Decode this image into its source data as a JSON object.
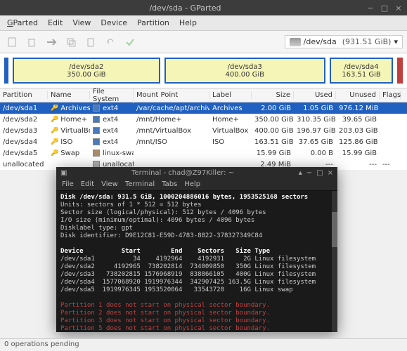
{
  "window": {
    "title": "/dev/sda - GParted"
  },
  "menu": {
    "gparted": "GParted",
    "edit": "Edit",
    "view": "View",
    "device": "Device",
    "partition": "Partition",
    "help": "Help"
  },
  "toolbar": {
    "device": "/dev/sda",
    "device_size": "(931.51 GiB)"
  },
  "partmap": {
    "s2_name": "/dev/sda2",
    "s2_size": "350.00 GiB",
    "s3_name": "/dev/sda3",
    "s3_size": "400.00 GiB",
    "s4_name": "/dev/sda4",
    "s4_size": "163.51 GiB"
  },
  "headers": {
    "partition": "Partition",
    "name": "Name",
    "fs": "File System",
    "mp": "Mount Point",
    "label": "Label",
    "size": "Size",
    "used": "Used",
    "unused": "Unused",
    "flags": "Flags"
  },
  "rows": [
    {
      "part": "/dev/sda1",
      "name": "Archives",
      "fs": "ext4",
      "fsc": "fs-ext4",
      "mp": "/var/cache/apt/archives",
      "label": "Archives",
      "size": "2.00 GiB",
      "used": "1.05 GiB",
      "unused": "976.12 MiB",
      "flags": "",
      "key": true,
      "sel": true
    },
    {
      "part": "/dev/sda2",
      "name": "Home+",
      "fs": "ext4",
      "fsc": "fs-ext4",
      "mp": "/mnt/Home+",
      "label": "Home+",
      "size": "350.00 GiB",
      "used": "310.35 GiB",
      "unused": "39.65 GiB",
      "flags": "",
      "key": true
    },
    {
      "part": "/dev/sda3",
      "name": "VirtualBox",
      "fs": "ext4",
      "fsc": "fs-ext4",
      "mp": "/mnt/VirtualBox",
      "label": "VirtualBox",
      "size": "400.00 GiB",
      "used": "196.97 GiB",
      "unused": "203.03 GiB",
      "flags": "",
      "key": true
    },
    {
      "part": "/dev/sda4",
      "name": "ISO",
      "fs": "ext4",
      "fsc": "fs-ext4",
      "mp": "/mnt/ISO",
      "label": "ISO",
      "size": "163.51 GiB",
      "used": "37.65 GiB",
      "unused": "125.86 GiB",
      "flags": "",
      "key": true
    },
    {
      "part": "/dev/sda5",
      "name": "Swap",
      "fs": "linux-swap",
      "fsc": "fs-swap",
      "mp": "",
      "label": "",
      "size": "15.99 GiB",
      "used": "0.00 B",
      "unused": "15.99 GiB",
      "flags": "",
      "key": true
    },
    {
      "part": "unallocated",
      "name": "",
      "fs": "unallocated",
      "fsc": "fs-unalloc",
      "mp": "",
      "label": "",
      "size": "2.49 MiB",
      "used": "---",
      "unused": "---",
      "flags": "---",
      "key": false
    }
  ],
  "terminal": {
    "title": "Terminal - chad@Z97Killer: ~",
    "menu": {
      "file": "File",
      "edit": "Edit",
      "view": "View",
      "terminal": "Terminal",
      "tabs": "Tabs",
      "help": "Help"
    },
    "l1": "Disk /dev/sda: 931.5 GiB, 1000204886016 bytes, 1953525168 sectors",
    "l2": "Units: sectors of 1 * 512 = 512 bytes",
    "l3": "Sector size (logical/physical): 512 bytes / 4096 bytes",
    "l4": "I/O size (minimum/optimal): 4096 bytes / 4096 bytes",
    "l5": "Disklabel type: gpt",
    "l6": "Disk identifier: D9E12C81-E59D-4783-8822-378327349C84",
    "h1": "Device          Start        End    Sectors   Size Type",
    "d1": "/dev/sda1          34    4192964    4192931     2G Linux filesystem",
    "d2": "/dev/sda2     4192965  738202814  734009850   350G Linux filesystem",
    "d3": "/dev/sda3   738202815 1576968919  838866105   400G Linux filesystem",
    "d4": "/dev/sda4  1577068920 1919976344  342907425 163.5G Linux filesystem",
    "d5": "/dev/sda5  1919976345 1953520064   33543720    16G Linux swap",
    "w1": "Partition 1 does not start on physical sector boundary.",
    "w2": "Partition 2 does not start on physical sector boundary.",
    "w3": "Partition 3 does not start on physical sector boundary.",
    "w4": "Partition 5 does not start on physical sector boundary."
  },
  "status": "0 operations pending"
}
